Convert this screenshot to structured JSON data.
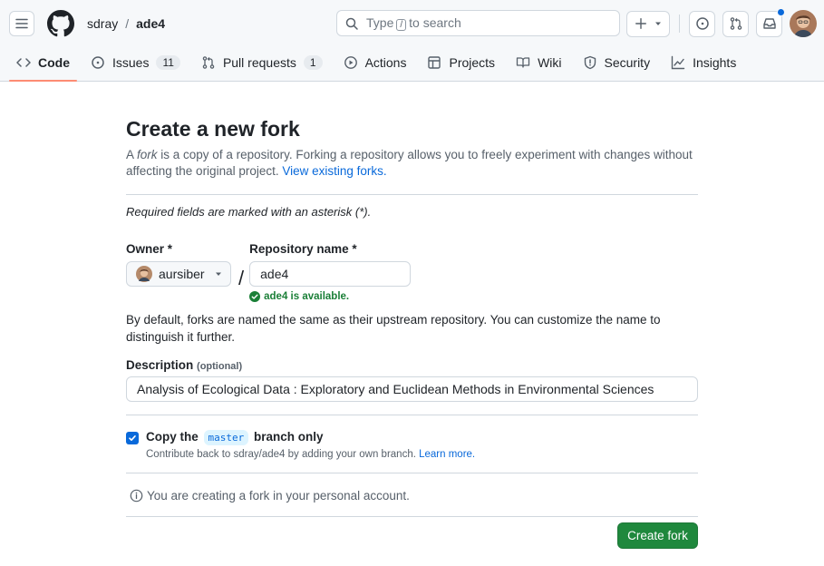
{
  "header": {
    "owner": "sdray",
    "separator": "/",
    "repo": "ade4",
    "search_pre": "Type",
    "search_key": "/",
    "search_post": "to search",
    "notification_indicator_color": "#0969da"
  },
  "tabs": [
    {
      "label": "Code",
      "icon": "code-icon",
      "active": true
    },
    {
      "label": "Issues",
      "icon": "issue-icon",
      "count": "11"
    },
    {
      "label": "Pull requests",
      "icon": "pull-request-icon",
      "count": "1"
    },
    {
      "label": "Actions",
      "icon": "play-icon"
    },
    {
      "label": "Projects",
      "icon": "table-icon"
    },
    {
      "label": "Wiki",
      "icon": "book-icon"
    },
    {
      "label": "Security",
      "icon": "shield-icon"
    },
    {
      "label": "Insights",
      "icon": "graph-icon"
    }
  ],
  "form": {
    "title": "Create a new fork",
    "lead_a": "A ",
    "lead_em": "fork",
    "lead_b": " is a copy of a repository. Forking a repository allows you to freely experiment with changes without affecting the original project.",
    "lead_link": "View existing forks.",
    "required_note": "Required fields are marked with an asterisk (*).",
    "owner_label": "Owner *",
    "owner_value": "aursiber",
    "slash": "/",
    "repo_label": "Repository name *",
    "repo_value": "ade4",
    "availability": "ade4 is available.",
    "naming_note": "By default, forks are named the same as their upstream repository. You can customize the name to distinguish it further.",
    "description_label": "Description",
    "description_optional": "(optional)",
    "description_value": "Analysis of Ecological Data : Exploratory and Euclidean Methods in Environmental Sciences",
    "copy_pre": "Copy the",
    "copy_branch": "master",
    "copy_post": "branch only",
    "copy_checked": true,
    "contribute_note": "Contribute back to sdray/ade4 by adding your own branch.",
    "learn_more": "Learn more.",
    "personal_note": "You are creating a fork in your personal account.",
    "submit": "Create fork"
  },
  "colors": {
    "accent": "#0969da",
    "success": "#1a7f37",
    "primary_button": "#1f883d",
    "active_tab_underline": "#fd8c73"
  }
}
